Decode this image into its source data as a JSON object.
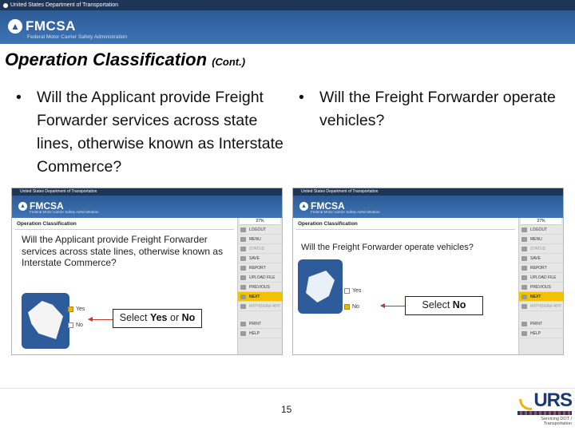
{
  "gov_bar": {
    "text": "United States Department of Transportation"
  },
  "header": {
    "logo": "FMCSA",
    "logo_sub": "Federal Motor Carrier Safety Administration"
  },
  "slide": {
    "title": "Operation Classification",
    "title_suffix": "(Cont.)",
    "bullet1": "Will the Applicant provide Freight Forwarder services across state lines, otherwise known as Interstate Commerce?",
    "bullet2": "Will the Freight Forwarder operate vehicles?",
    "page_number": "15"
  },
  "screens": {
    "gov_text": "United States Department of Transportation",
    "logo": "FMCSA",
    "logo_sub": "Federal Motor Carrier Safety Administration",
    "section": "Operation Classification",
    "pct": "27%",
    "menu": [
      "LOGOUT",
      "MENU",
      "STATUS",
      "SAVE",
      "REPORT",
      "UPLOAD FILE",
      "PREVIOUS",
      "NEXT",
      "WITHDRAW APP",
      "PRINT",
      "HELP"
    ],
    "left": {
      "question": "Will the Applicant provide Freight Forwarder services across state lines, otherwise known as Interstate Commerce?",
      "options": [
        "Yes",
        "No"
      ],
      "callout_prefix": "Select ",
      "callout_yes": "Yes",
      "callout_mid": " or ",
      "callout_no": "No"
    },
    "right": {
      "question": "Will the Freight Forwarder operate vehicles?",
      "options": [
        "Yes",
        "No"
      ],
      "callout_prefix": "Select ",
      "callout_no": "No"
    }
  },
  "footer": {
    "brand": "URS",
    "tagline": "Servicing DOT / Transportation"
  },
  "colors": {
    "header": "#2c5b96",
    "highlight": "#f2c200",
    "arrow": "#c0392b"
  }
}
